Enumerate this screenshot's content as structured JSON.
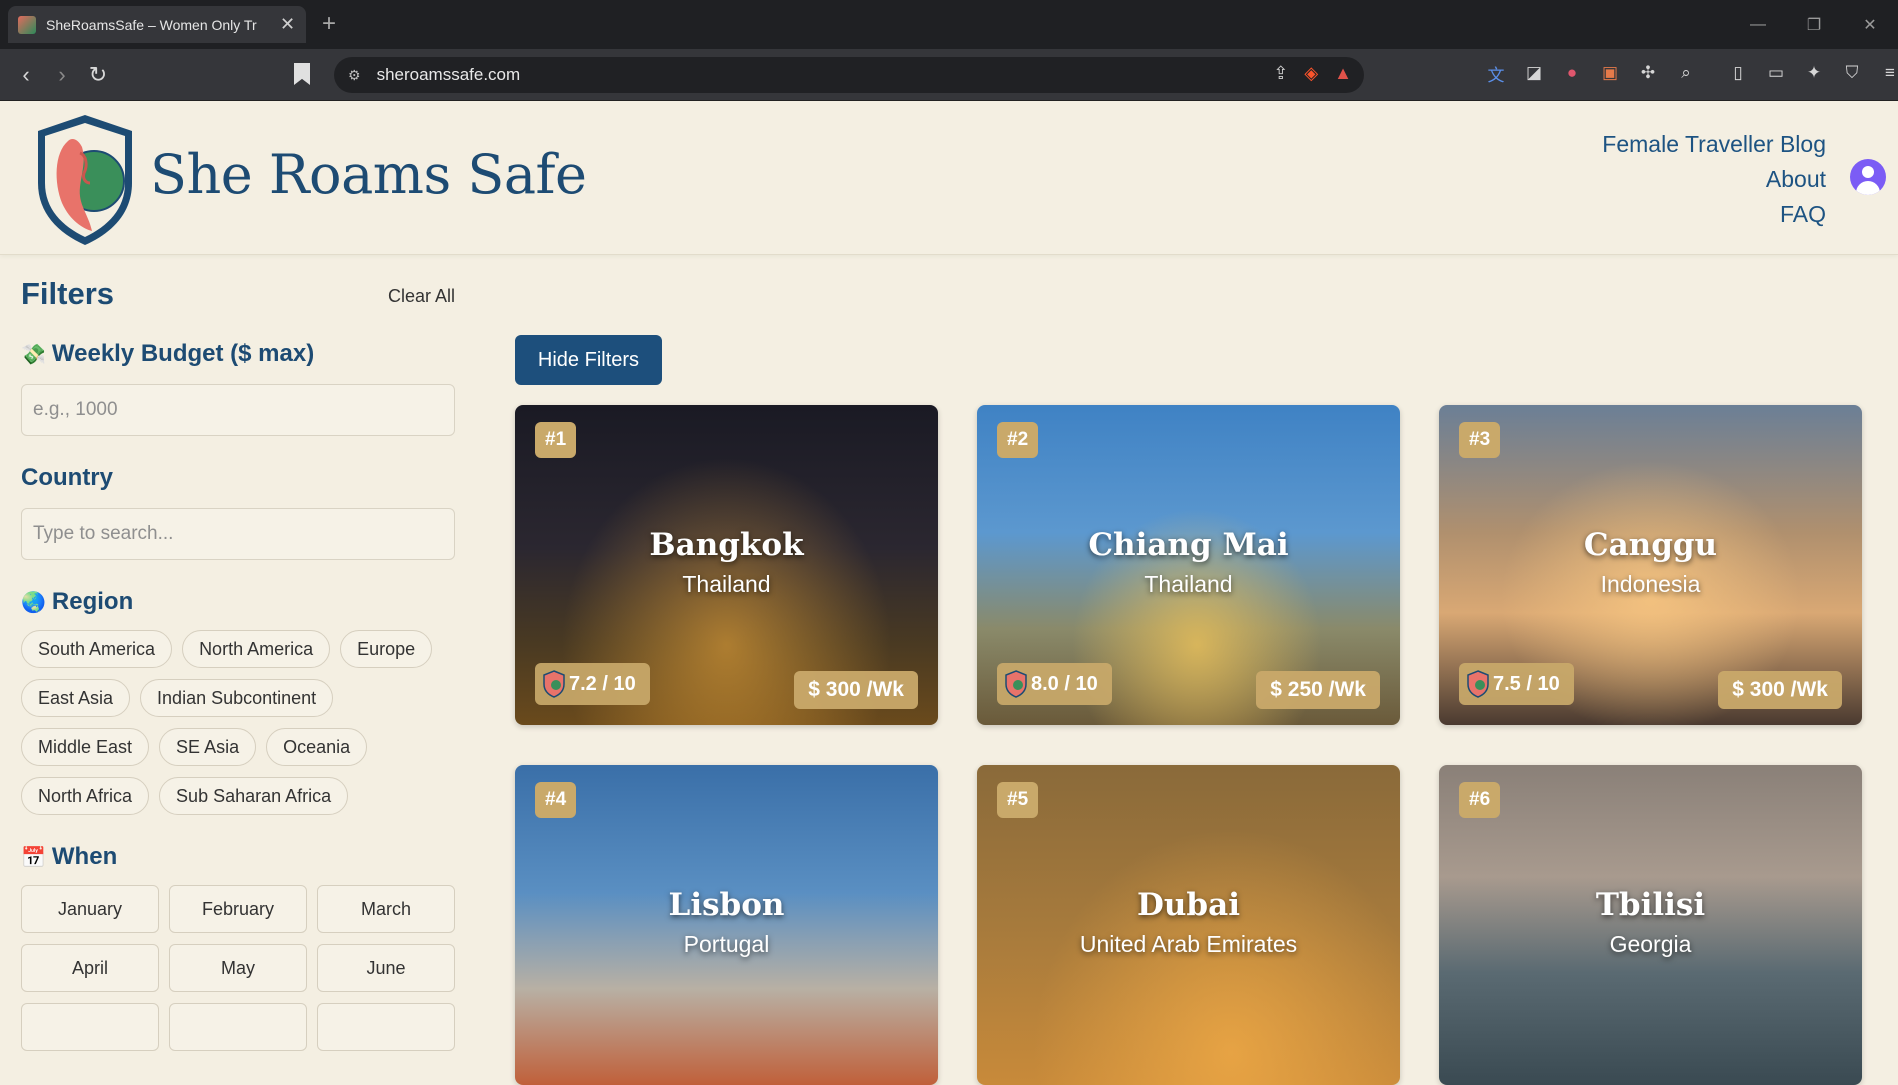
{
  "browser": {
    "tab_title": "SheRoamsSafe – Women Only Tr",
    "url": "sheroamssafe.com"
  },
  "header": {
    "brand": "She Roams Safe",
    "nav": [
      "Female Traveller Blog",
      "About",
      "FAQ"
    ]
  },
  "filters": {
    "title": "Filters",
    "clear_all": "Clear All",
    "budget_label": "Weekly Budget ($ max)",
    "budget_placeholder": "e.g., 1000",
    "country_label": "Country",
    "country_placeholder": "Type to search...",
    "region_label": "Region",
    "regions": [
      "South America",
      "North America",
      "Europe",
      "East Asia",
      "Indian Subcontinent",
      "Middle East",
      "SE Asia",
      "Oceania",
      "North Africa",
      "Sub Saharan Africa"
    ],
    "when_label": "When",
    "months": [
      "January",
      "February",
      "March",
      "April",
      "May",
      "June",
      "",
      "",
      ""
    ]
  },
  "main": {
    "hide_filters": "Hide Filters",
    "cards": [
      {
        "rank": "#1",
        "city": "Bangkok",
        "country": "Thailand",
        "safety": "7.2 / 10",
        "price": "$ 300 /Wk"
      },
      {
        "rank": "#2",
        "city": "Chiang Mai",
        "country": "Thailand",
        "safety": "8.0 / 10",
        "price": "$ 250 /Wk"
      },
      {
        "rank": "#3",
        "city": "Canggu",
        "country": "Indonesia",
        "safety": "7.5 / 10",
        "price": "$ 300 /Wk"
      },
      {
        "rank": "#4",
        "city": "Lisbon",
        "country": "Portugal",
        "safety": "",
        "price": ""
      },
      {
        "rank": "#5",
        "city": "Dubai",
        "country": "United Arab Emirates",
        "safety": "",
        "price": ""
      },
      {
        "rank": "#6",
        "city": "Tbilisi",
        "country": "Georgia",
        "safety": "",
        "price": ""
      }
    ]
  },
  "colors": {
    "brand_blue": "#1d4b73",
    "gold": "#c9a96a",
    "cream": "#f4efe2"
  }
}
